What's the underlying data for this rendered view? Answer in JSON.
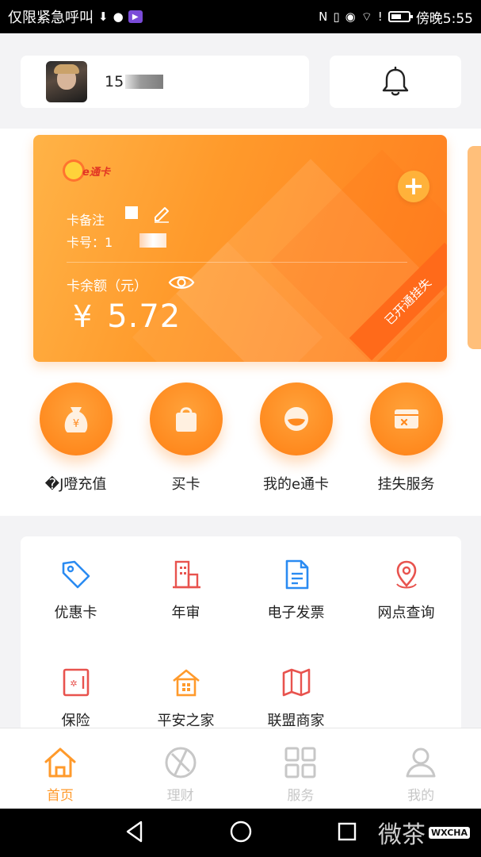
{
  "status_bar": {
    "left_text": "仅限紧急呼叫",
    "time_text": "傍晚5:55"
  },
  "user": {
    "phone_prefix": "15"
  },
  "card": {
    "brand": "e通卡",
    "note_label": "卡备注",
    "number_label": "卡号：1",
    "balance_label": "卡余额（元）",
    "currency_symbol": "¥",
    "balance_value": "5.72",
    "ribbon_text": "已开通挂失"
  },
  "quick_actions": [
    {
      "label": "�J噔充值"
    },
    {
      "label": "买卡"
    },
    {
      "label": "我的e通卡"
    },
    {
      "label": "挂失服务"
    }
  ],
  "services": [
    {
      "label": "优惠卡",
      "icon": "tag-icon"
    },
    {
      "label": "年审",
      "icon": "building-icon"
    },
    {
      "label": "电子发票",
      "icon": "document-icon"
    },
    {
      "label": "网点查询",
      "icon": "map-pin-icon"
    },
    {
      "label": "保险",
      "icon": "safe-icon"
    },
    {
      "label": "平安之家",
      "icon": "house-icon"
    },
    {
      "label": "联盟商家",
      "icon": "map-icon"
    }
  ],
  "tabs": [
    {
      "label": "首页",
      "active": true
    },
    {
      "label": "理财",
      "active": false
    },
    {
      "label": "服务",
      "active": false
    },
    {
      "label": "我的",
      "active": false
    }
  ],
  "watermark": {
    "text": "微茶",
    "badge": "WXCHA"
  },
  "colors": {
    "accent": "#ff9a2b",
    "card_orange": "#ff8a1f"
  }
}
